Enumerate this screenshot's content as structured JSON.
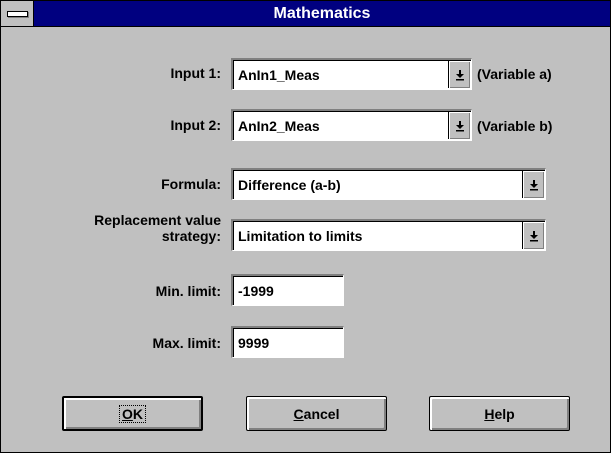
{
  "window": {
    "title": "Mathematics",
    "system_menu_icon": "system-menu-icon"
  },
  "form": {
    "input1": {
      "label": "Input 1:",
      "value": "AnIn1_Meas",
      "hint": "(Variable a)"
    },
    "input2": {
      "label": "Input 2:",
      "value": "AnIn2_Meas",
      "hint": "(Variable b)"
    },
    "formula": {
      "label": "Formula:",
      "value": "Difference (a-b)"
    },
    "replacement": {
      "label_line1": "Replacement value",
      "label_line2": "strategy:",
      "value": "Limitation to limits"
    },
    "min_limit": {
      "label": "Min. limit:",
      "value": "-1999"
    },
    "max_limit": {
      "label": "Max. limit:",
      "value": "9999"
    }
  },
  "buttons": {
    "ok": {
      "mnemonic": "O",
      "rest": "K"
    },
    "cancel": {
      "mnemonic": "C",
      "rest": "ancel"
    },
    "help": {
      "mnemonic": "H",
      "rest": "elp"
    }
  },
  "icons": {
    "dropdown": "dropdown-arrow-icon"
  }
}
